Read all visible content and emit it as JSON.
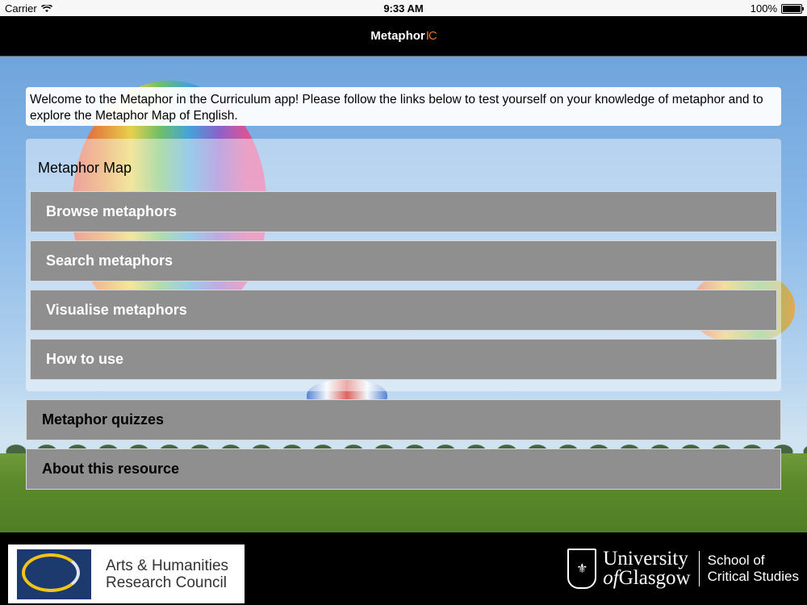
{
  "status_bar": {
    "carrier": "Carrier",
    "time": "9:33 AM",
    "battery": "100%"
  },
  "nav": {
    "title": "Metaphor",
    "logo_mark": "IC"
  },
  "welcome_text": "Welcome to the Metaphor in the Curriculum app! Please follow the links below to test yourself on your knowledge of metaphor and to explore the Metaphor Map of English.",
  "metaphor_map": {
    "title": "Metaphor Map",
    "items": [
      {
        "label": "Browse metaphors"
      },
      {
        "label": "Search metaphors"
      },
      {
        "label": "Visualise metaphors"
      },
      {
        "label": "How to use"
      }
    ]
  },
  "sections": [
    {
      "label": "Metaphor quizzes"
    },
    {
      "label": "About this resource"
    }
  ],
  "footer": {
    "ahrc_line1": "Arts & Humanities",
    "ahrc_line2": "Research Council",
    "uog_line1": "University",
    "uog_line2_italic": "of",
    "uog_line2_rest": "Glasgow",
    "school_line1": "School of",
    "school_line2": "Critical Studies"
  },
  "colors": {
    "accent": "#e8731e",
    "button_bg": "#8f8f8f"
  }
}
